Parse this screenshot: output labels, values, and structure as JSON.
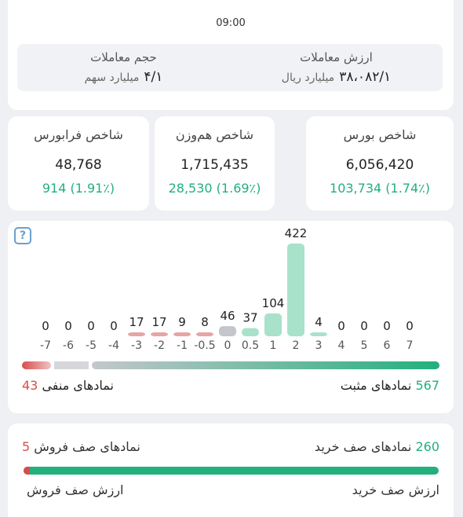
{
  "top": {
    "time": "09:00",
    "trade_value": {
      "title": "ارزش معاملات",
      "value": "۳۸،۰۸۲/۱",
      "unit": "میلیارد ریال"
    },
    "trade_volume": {
      "title": "حجم معاملات",
      "value": "۴/۱",
      "unit": "میلیارد سهم"
    }
  },
  "indices": [
    {
      "title": "شاخص بورس",
      "value": "6,056,420",
      "change": "103,734 (1.74٪)"
    },
    {
      "title": "شاخص هم‌وزن",
      "value": "1,715,435",
      "change": "28,530 (1.69٪)"
    },
    {
      "title": "شاخص فرابورس",
      "value": "48,768",
      "change": "914 (1.91٪)"
    }
  ],
  "distribution": {
    "help_icon": "question-icon",
    "positive_label": "نمادهای مثبت",
    "positive_count": "567",
    "negative_label": "نمادهای منفی",
    "negative_count": "43",
    "balance": {
      "negative": 43,
      "neutral": 8,
      "positive": 567
    }
  },
  "chart_data": {
    "type": "bar",
    "categories": [
      "-7",
      "-6",
      "-5",
      "-4",
      "-3",
      "-2",
      "-1",
      "-0.5",
      "0",
      "0.5",
      "1",
      "2",
      "3",
      "4",
      "5",
      "6",
      "7"
    ],
    "values": [
      0,
      0,
      0,
      0,
      17,
      17,
      9,
      8,
      46,
      37,
      104,
      422,
      4,
      0,
      0,
      0,
      0
    ],
    "colors": {
      "negative": "#e6a4a4",
      "neutral": "#c4c6cc",
      "positive": "#a8e2cb"
    }
  },
  "queue": {
    "buy_label": "نمادهای صف خرید",
    "buy_count": "260",
    "sell_label": "نمادهای صف فروش",
    "sell_count": "5",
    "buy_value_label": "ارزش صف خرید",
    "sell_value_label": "ارزش صف فروش",
    "buy_ratio": 0.985
  },
  "colors": {
    "positive": "#22b07d",
    "negative": "#d84c4c",
    "accent": "#6b9fcf"
  }
}
